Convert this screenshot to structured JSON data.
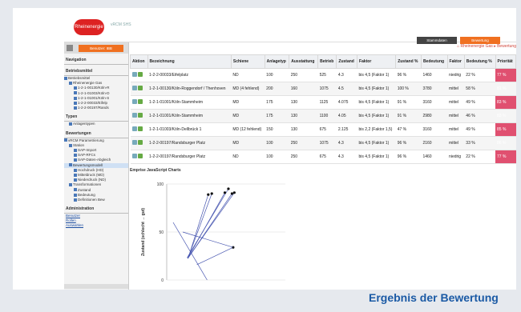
{
  "app": {
    "logo_text": "Rheinenergie",
    "title": "vRCM SHS"
  },
  "tabs": [
    {
      "label": "Stammdaten"
    },
    {
      "label": "Bewertung"
    }
  ],
  "left": {
    "button_label": "Benutzer: IBB",
    "nav_title": "Navigation",
    "sections": [
      {
        "title": "Betriebsmittel",
        "items": [
          "Betriebsmittel",
          "Rheinenergie Gas",
          "1-2-1-00130/Köln-R",
          "1-2-1-01003/Köln-D",
          "1-2-1-01001/Köln-S",
          "1-2-2-00033/Eifelp",
          "1-2-2-00197/Rands"
        ]
      },
      {
        "title": "Typen",
        "items": [
          "Anlagentypen"
        ]
      },
      {
        "title": "Bewertungen",
        "items": [
          "vRCM Parametrierung",
          "Station",
          "SAP-Import",
          "SAP-RFCs",
          "SAP-Daten-Abgleich",
          "Bewertungsmodell",
          "Hochdruck (HD)",
          "Mitteldruck (MD)",
          "Niederdruck (ND)",
          "Transformationen",
          "Zustand",
          "Bedeutung",
          "Definitionen Bew"
        ]
      },
      {
        "title": "Administration",
        "items": []
      }
    ],
    "links": [
      "Benutzer",
      "Rollen",
      "Auswahlen"
    ]
  },
  "breadcrumb": "Rheinenergie Gas ▸ Bewertung",
  "table": {
    "headers": [
      "Aktion",
      "Bezeichnung",
      "Schiene",
      "Anlagetyp",
      "Ausstattung",
      "Betrieb",
      "Zustand",
      "Faktor",
      "Zustand %",
      "Bedeutung",
      "Faktor",
      "Bedeutung %",
      "Priorität"
    ],
    "rows": [
      [
        "",
        "1-2-2-00033/Eifelplatz",
        "ND",
        "100",
        "250",
        "525",
        "4.3",
        "bis 4,5 (Faktor 1)",
        "96 %",
        "1460",
        "niedrig",
        "22 %",
        "77 %"
      ],
      [
        "",
        "1-2-1-00130/Köln-Roggendorf / Thenhoven",
        "MD (4 fehlend)",
        "200",
        "160",
        "1075",
        "4.5",
        "bis 4,5 (Faktor 1)",
        "100 %",
        "3780",
        "mittel",
        "58 %",
        "81 %"
      ],
      [
        "",
        "1-2-1-01001/Köln-Stammheim",
        "MD",
        "175",
        "130",
        "1125",
        "4.075",
        "bis 4,5 (Faktor 1)",
        "91 %",
        "3160",
        "mittel",
        "49 %",
        "83 %"
      ],
      [
        "",
        "1-2-1-01001/Köln-Stammheim",
        "MD",
        "175",
        "130",
        "1100",
        "4.05",
        "bis 4,5 (Faktor 1)",
        "91 %",
        "2980",
        "mittel",
        "46 %",
        "83 %"
      ],
      [
        "",
        "1-2-1-01003/Köln-Dellbrück 1",
        "MD (12 fehlend)",
        "150",
        "130",
        "675",
        "2.125",
        "bis 2,2 (Faktor 1,5)",
        "47 %",
        "3160",
        "mittel",
        "49 %",
        "85 %"
      ],
      [
        "",
        "1-2-2-00197/Randsburger Platz",
        "MD",
        "100",
        "250",
        "1075",
        "4.3",
        "bis 4,5 (Faktor 1)",
        "96 %",
        "2160",
        "mittel",
        "33 %",
        "86 %"
      ],
      [
        "",
        "1-2-2-00197/Randsburger Platz",
        "ND",
        "100",
        "250",
        "675",
        "4.3",
        "bis 4,5 (Faktor 1)",
        "96 %",
        "1460",
        "niedrig",
        "22 %",
        "77 %"
      ]
    ]
  },
  "chart_title": "Emprise JavaScript Charts",
  "chart_data": {
    "type": "scatter",
    "title": "",
    "ylabel": "Zustand (schlecht → gut)",
    "yticks": [
      "100",
      "50",
      "0"
    ],
    "points": [
      {
        "x": 52,
        "y": 95
      },
      {
        "x": 57,
        "y": 91
      },
      {
        "x": 55,
        "y": 90
      },
      {
        "x": 49,
        "y": 91
      },
      {
        "x": 35,
        "y": 89
      },
      {
        "x": 38,
        "y": 90
      },
      {
        "x": 56,
        "y": 34
      }
    ]
  },
  "caption": "Ergebnis der Bewertung"
}
